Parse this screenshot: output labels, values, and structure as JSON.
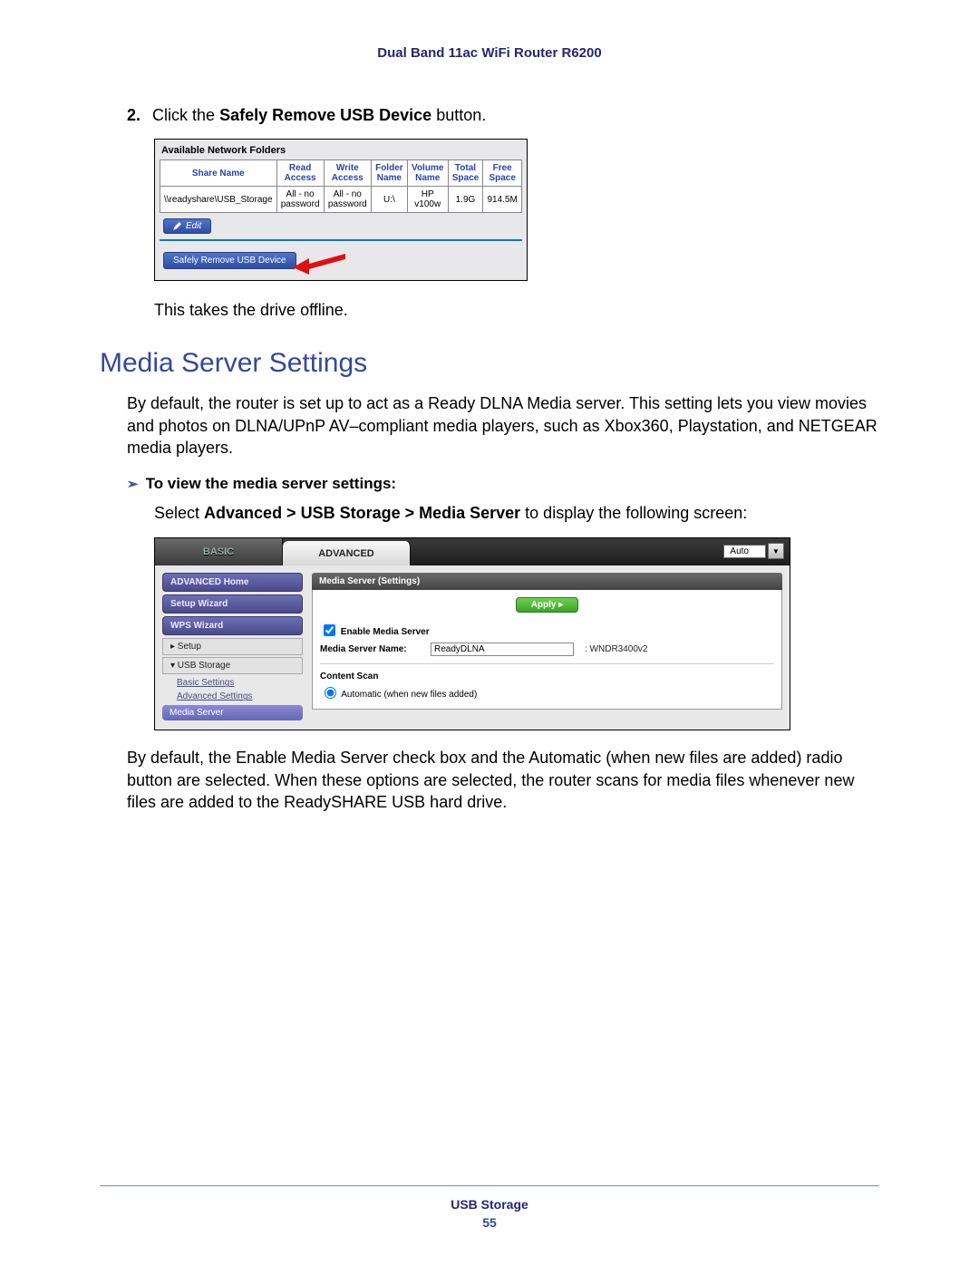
{
  "header": "Dual Band 11ac WiFi Router R6200",
  "step": {
    "num": "2.",
    "pre": "Click the ",
    "bold": "Safely Remove USB Device",
    "post": " button."
  },
  "fig1": {
    "title": "Available Network Folders",
    "headers": {
      "share": "Share Name",
      "read": "Read Access",
      "write": "Write Access",
      "folder": "Folder Name",
      "volume": "Volume Name",
      "total": "Total Space",
      "free": "Free Space"
    },
    "row": {
      "share": "\\\\readyshare\\USB_Storage",
      "read": "All - no password",
      "write": "All - no password",
      "folder": "U:\\",
      "volume": "HP v100w",
      "total": "1.9G",
      "free": "914.5M"
    },
    "edit_label": "Edit",
    "remove_label": "Safely Remove USB Device"
  },
  "after_fig1": "This takes the drive offline.",
  "section_title": "Media Server Settings",
  "para1": "By default, the router is set up to act as a Ready DLNA Media server. This setting lets you view movies and photos on DLNA/UPnP AV–compliant media players, such as Xbox360, Playstation, and NETGEAR media players.",
  "bullet": {
    "tri": "➢",
    "text": "To view the media server settings:"
  },
  "subpara": {
    "pre": "Select ",
    "bold": "Advanced > USB Storage > Media Server",
    "post": " to display the following screen:"
  },
  "fig2": {
    "tab_basic": "BASIC",
    "tab_advanced": "ADVANCED",
    "auto": "Auto",
    "side": {
      "adv_home": "ADVANCED Home",
      "setup_wizard": "Setup Wizard",
      "wps_wizard": "WPS Wizard",
      "setup": "▸ Setup",
      "usb_storage": "▾ USB Storage",
      "basic_settings": "Basic Settings",
      "advanced_settings": "Advanced Settings",
      "media_server": "Media Server"
    },
    "panel_title": "Media Server (Settings)",
    "apply": "Apply ▸",
    "enable": "Enable Media Server",
    "name_label": "Media Server Name:",
    "name_value": "ReadyDLNA",
    "name_suffix": ": WNDR3400v2",
    "content_scan": "Content Scan",
    "auto_scan": "Automatic (when new files added)"
  },
  "para2": "By default, the Enable Media Server check box and the Automatic (when new files are added) radio button are selected. When these options are selected, the router scans for media files whenever new files are added to the ReadySHARE USB hard drive.",
  "footer": {
    "section": "USB Storage",
    "page": "55"
  }
}
